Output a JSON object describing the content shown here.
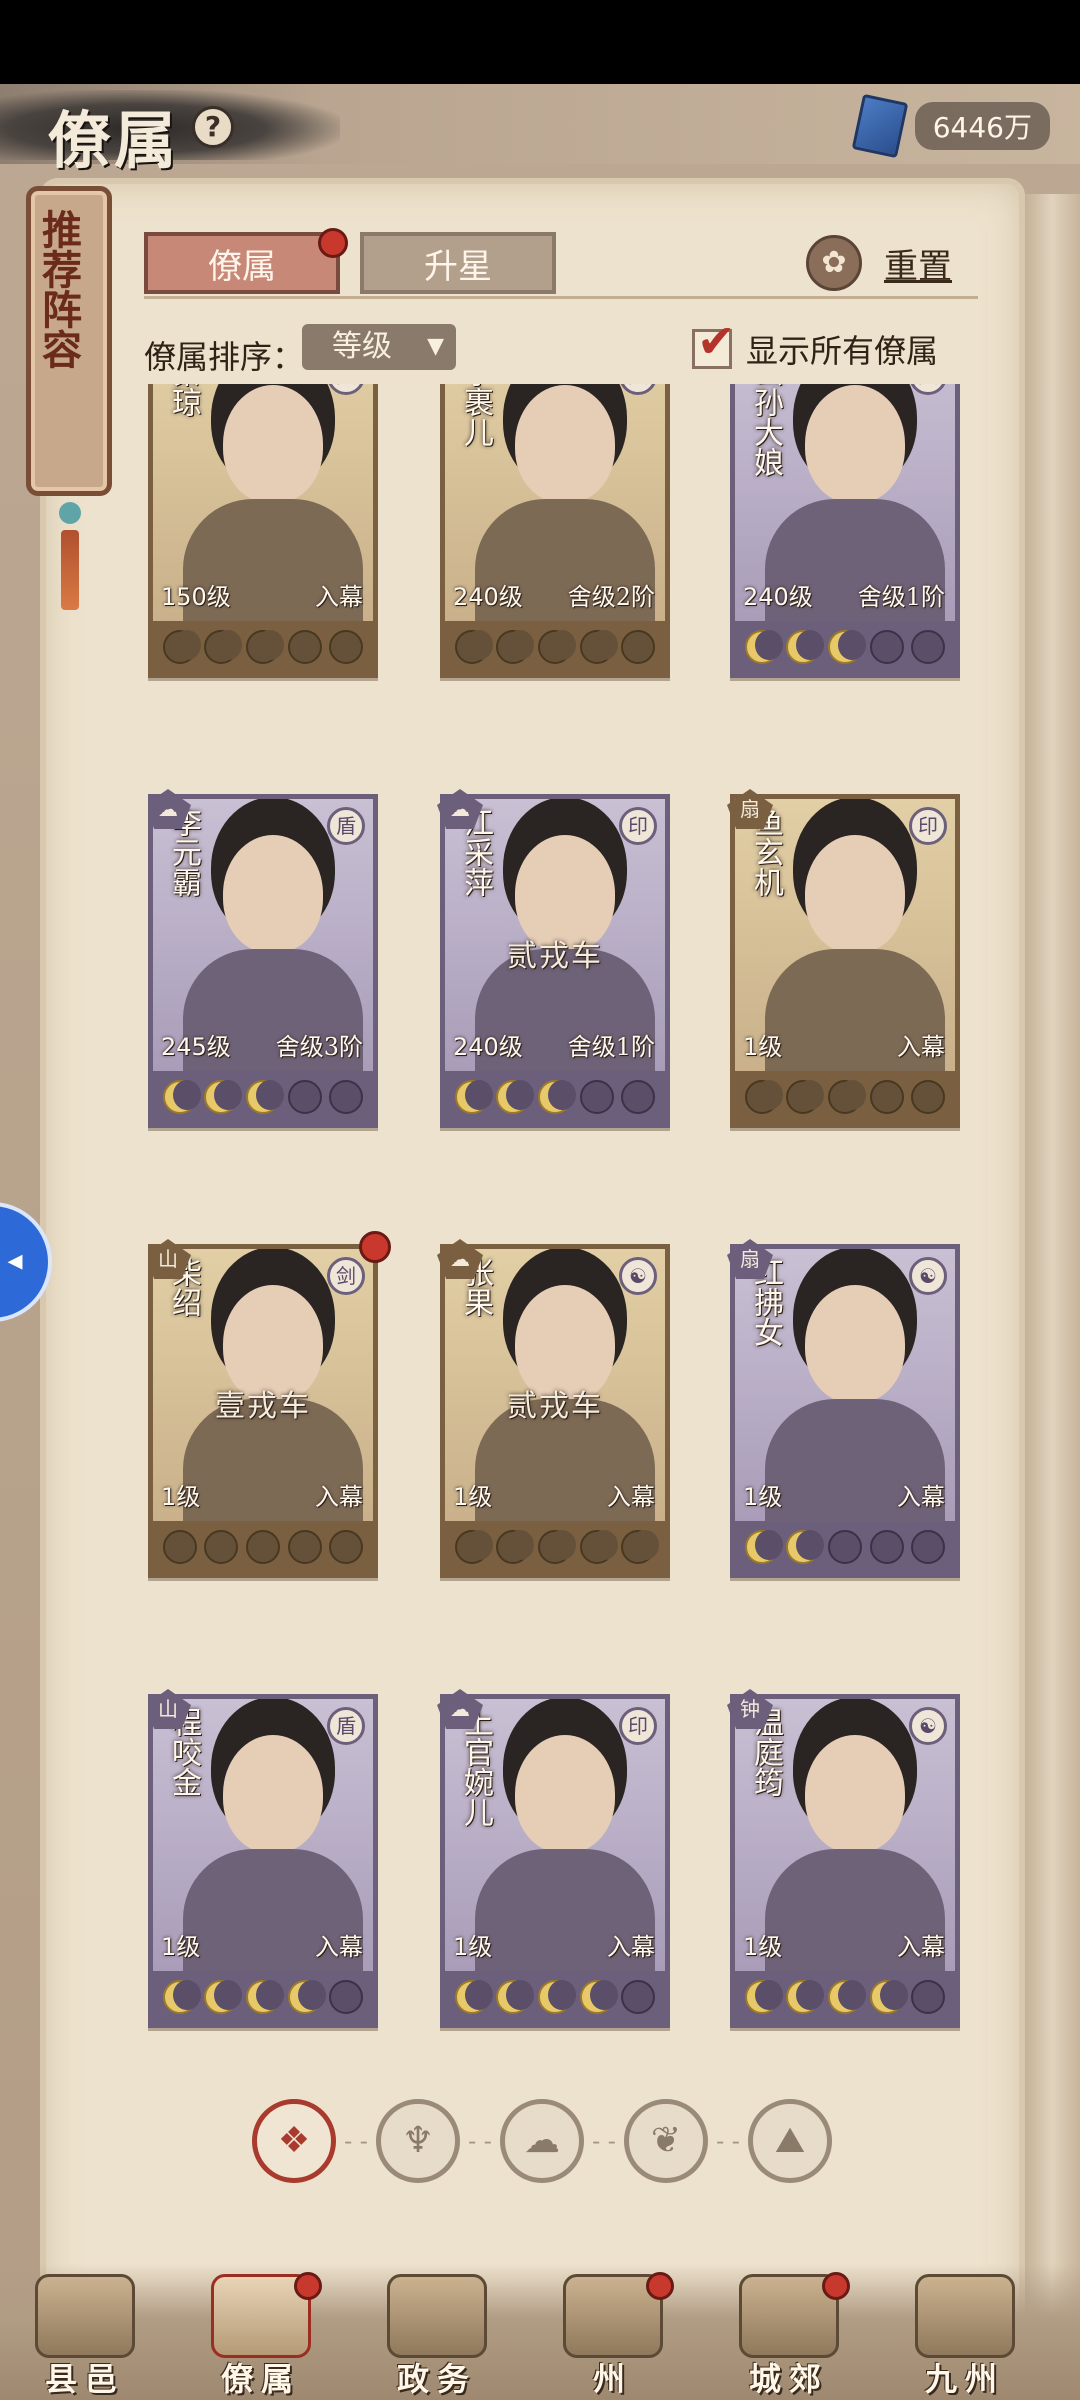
{
  "header": {
    "title": "僚属",
    "help_icon": "?",
    "currency": "6446万"
  },
  "banner": {
    "text": "推荐阵容"
  },
  "tabs": [
    {
      "label": "僚属",
      "active": true,
      "badge": true
    },
    {
      "label": "升星",
      "active": false,
      "badge": false
    }
  ],
  "reset": {
    "label": "重置"
  },
  "sort": {
    "label": "僚属排序：",
    "value": "等级"
  },
  "show_all": {
    "label": "显示所有僚属",
    "checked": true
  },
  "cards": [
    {
      "name": "秦琼",
      "level": "150级",
      "status": "入幕",
      "overlay": "",
      "theme": "gold",
      "moons": [
        "lit",
        "lit",
        "lit",
        "off",
        "off"
      ],
      "badge": "人",
      "cls": "",
      "dot": false
    },
    {
      "name": "李裹儿",
      "level": "240级",
      "status": "舍级2阶",
      "overlay": "",
      "theme": "gold",
      "moons": [
        "lit",
        "lit",
        "lit",
        "lit",
        "off"
      ],
      "badge": "人",
      "cls": "",
      "dot": false
    },
    {
      "name": "公孙大娘",
      "level": "240级",
      "status": "舍级1阶",
      "overlay": "",
      "theme": "purple",
      "moons": [
        "lit",
        "lit",
        "lit",
        "off",
        "off"
      ],
      "badge": "人",
      "cls": "",
      "dot": false
    },
    {
      "name": "李元霸",
      "level": "245级",
      "status": "舍级3阶",
      "overlay": "",
      "theme": "purple",
      "moons": [
        "lit",
        "lit",
        "lit",
        "off",
        "off"
      ],
      "badge": "盾",
      "cls": "☁",
      "dot": false
    },
    {
      "name": "江采萍",
      "level": "240级",
      "status": "舍级1阶",
      "overlay": "贰戎车",
      "theme": "purple",
      "moons": [
        "lit",
        "lit",
        "lit",
        "off",
        "off"
      ],
      "badge": "印",
      "cls": "☁",
      "dot": false
    },
    {
      "name": "鱼玄机",
      "level": "1级",
      "status": "入幕",
      "overlay": "",
      "theme": "gold",
      "moons": [
        "lit",
        "lit",
        "lit",
        "off",
        "off"
      ],
      "badge": "印",
      "cls": "扇",
      "dot": false
    },
    {
      "name": "柴绍",
      "level": "1级",
      "status": "入幕",
      "overlay": "壹戎车",
      "theme": "gold",
      "moons": [
        "red",
        "off",
        "off",
        "off",
        "off"
      ],
      "badge": "剑",
      "cls": "山",
      "dot": true
    },
    {
      "name": "张果",
      "level": "1级",
      "status": "入幕",
      "overlay": "贰戎车",
      "theme": "gold",
      "moons": [
        "lit",
        "lit",
        "lit",
        "lit",
        "lit"
      ],
      "badge": "☯",
      "cls": "☁",
      "dot": false
    },
    {
      "name": "红拂女",
      "level": "1级",
      "status": "入幕",
      "overlay": "",
      "theme": "purple",
      "moons": [
        "lit",
        "lit",
        "off",
        "off",
        "off"
      ],
      "badge": "☯",
      "cls": "扇",
      "dot": false
    },
    {
      "name": "程咬金",
      "level": "1级",
      "status": "入幕",
      "overlay": "",
      "theme": "purple",
      "moons": [
        "lit",
        "lit",
        "lit",
        "lit",
        "off"
      ],
      "badge": "盾",
      "cls": "山",
      "dot": false
    },
    {
      "name": "上官婉儿",
      "level": "1级",
      "status": "入幕",
      "overlay": "",
      "theme": "purple",
      "moons": [
        "lit",
        "lit",
        "lit",
        "lit",
        "off"
      ],
      "badge": "印",
      "cls": "☁",
      "dot": false
    },
    {
      "name": "温庭筠",
      "level": "1级",
      "status": "入幕",
      "overlay": "",
      "theme": "purple",
      "moons": [
        "lit",
        "lit",
        "lit",
        "lit",
        "off"
      ],
      "badge": "☯",
      "cls": "钟",
      "dot": false
    }
  ],
  "filters": [
    {
      "icon": "diamond-lattice-icon",
      "glyph": "❖",
      "active": true
    },
    {
      "icon": "bell-icon",
      "glyph": "♆",
      "active": false
    },
    {
      "icon": "cloud-icon",
      "glyph": "☁",
      "active": false
    },
    {
      "icon": "fan-icon",
      "glyph": "❦",
      "active": false
    },
    {
      "icon": "mountain-icon",
      "glyph": "⛰",
      "active": false
    }
  ],
  "nav": [
    {
      "label": "县邑",
      "active": false,
      "badge": false
    },
    {
      "label": "僚属",
      "active": true,
      "badge": true
    },
    {
      "label": "政务",
      "active": false,
      "badge": false
    },
    {
      "label": "州",
      "active": false,
      "badge": true
    },
    {
      "label": "城郊",
      "active": false,
      "badge": true
    },
    {
      "label": "九州",
      "active": false,
      "badge": false
    }
  ],
  "float_button": {
    "icon": "sound-wave-icon",
    "glyph": "◂"
  },
  "colors": {
    "accent_red": "#c8382c",
    "purple_frame": "#6b5f7c",
    "gold_frame": "#7a6040",
    "paper": "#ede2cd"
  }
}
